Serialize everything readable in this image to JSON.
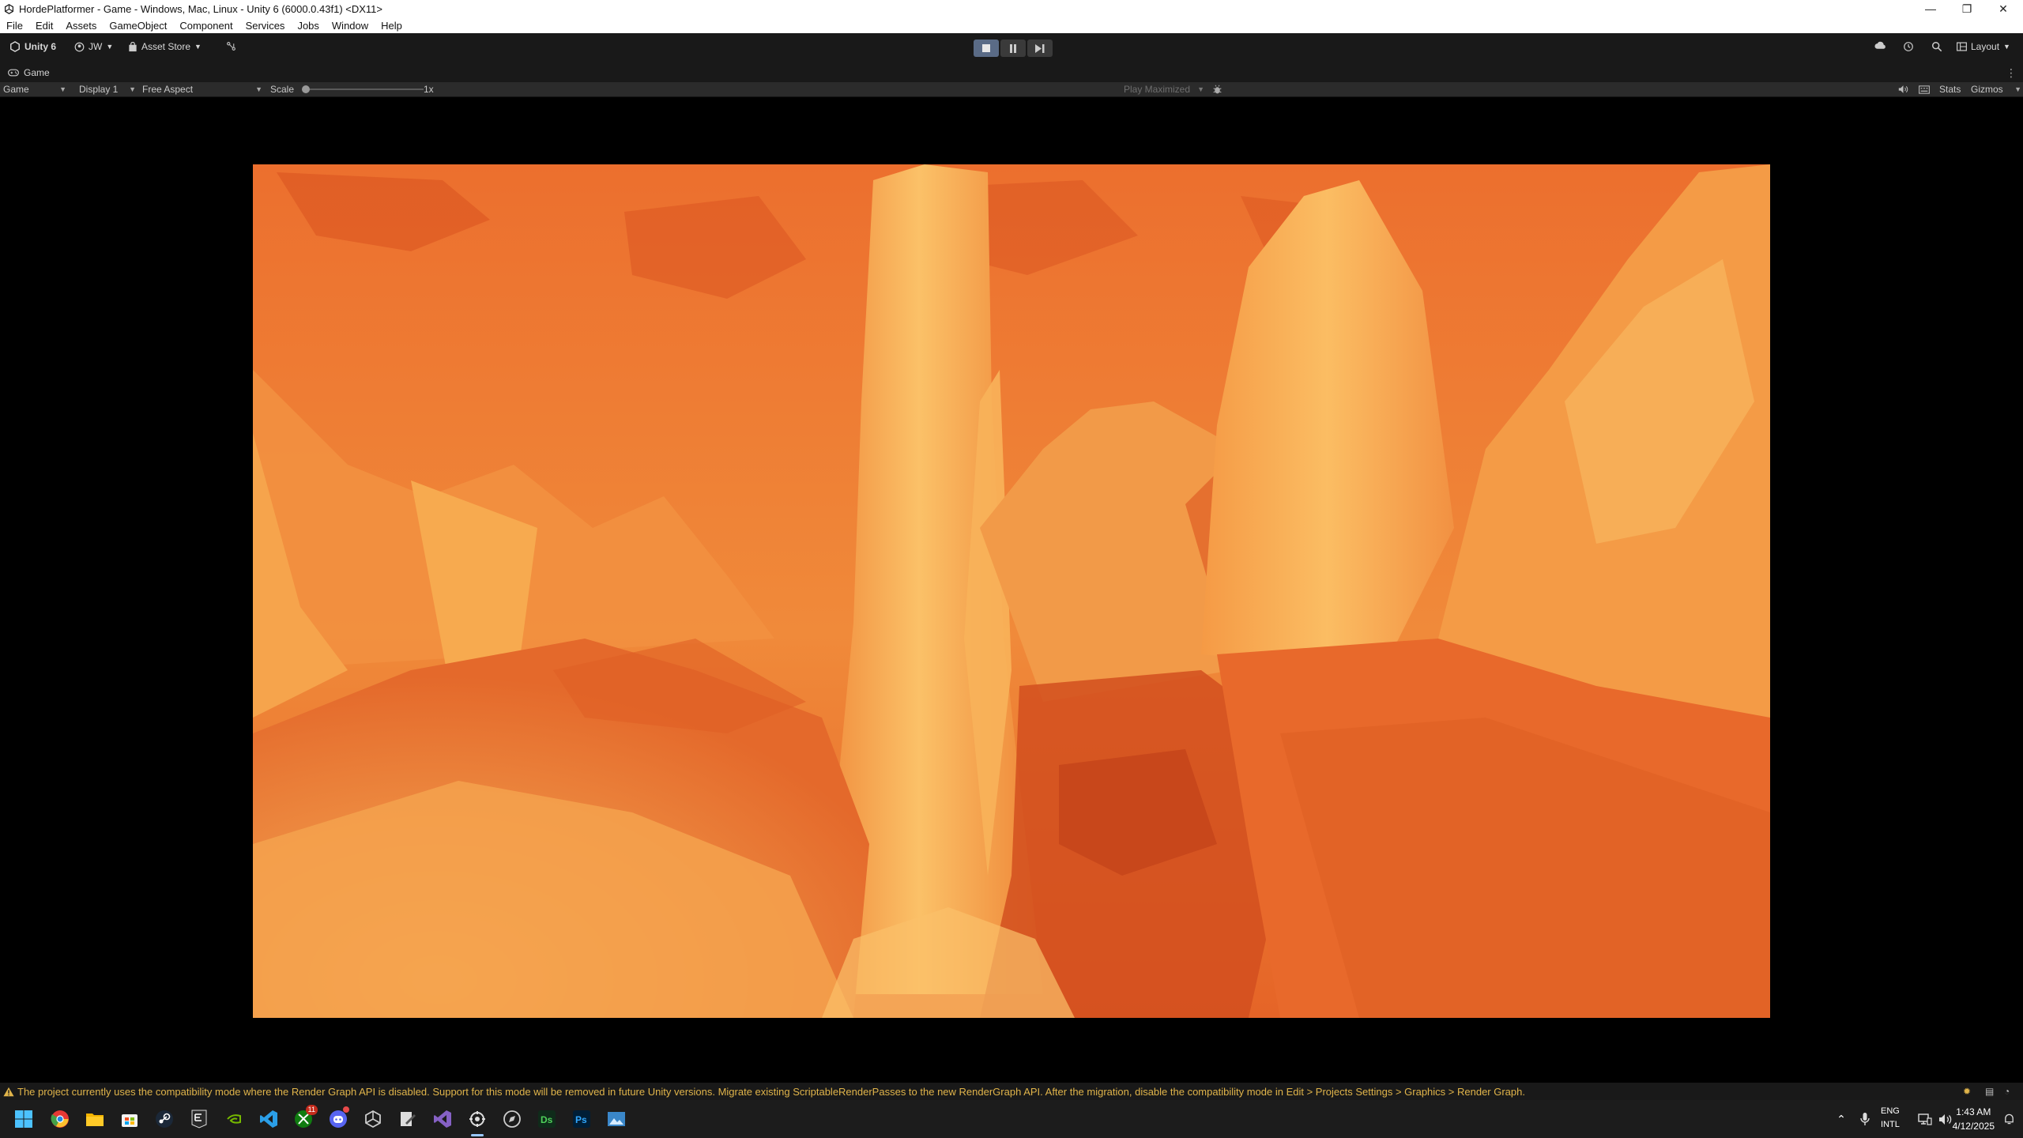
{
  "window": {
    "title": "HordePlatformer - Game - Windows, Mac, Linux - Unity 6 (6000.0.43f1) <DX11>",
    "controls": {
      "minimize": "—",
      "maximize": "❐",
      "close": "✕"
    }
  },
  "menu": [
    "File",
    "Edit",
    "Assets",
    "GameObject",
    "Component",
    "Services",
    "Jobs",
    "Window",
    "Help"
  ],
  "toolbar": {
    "unity_label": "Unity 6",
    "account_label": "JW",
    "asset_store_label": "Asset Store",
    "layout_label": "Layout"
  },
  "tab": {
    "label": "Game"
  },
  "gamebar": {
    "mode": "Game",
    "display": "Display 1",
    "aspect": "Free Aspect",
    "scale_label": "Scale",
    "scale_value": "1x",
    "play_maximized": "Play Maximized",
    "stats": "Stats",
    "gizmos": "Gizmos"
  },
  "status": {
    "message": "The project currently uses the compatibility mode where the Render Graph API is disabled. Support for this mode will be removed in future Unity versions. Migrate existing ScriptableRenderPasses to the new RenderGraph API. After the migration, disable the compatibility mode in Edit > Projects Settings > Graphics > Render Graph."
  },
  "taskbar": {
    "xbox_badge": "11",
    "lang_top": "ENG",
    "lang_bottom": "INTL",
    "time": "1:43 AM",
    "date": "4/12/2025"
  },
  "colors": {
    "lava_base": "#e9692a",
    "lava_light": "#f7b558",
    "lava_dark": "#c4431a",
    "warning": "#e0b44a"
  }
}
